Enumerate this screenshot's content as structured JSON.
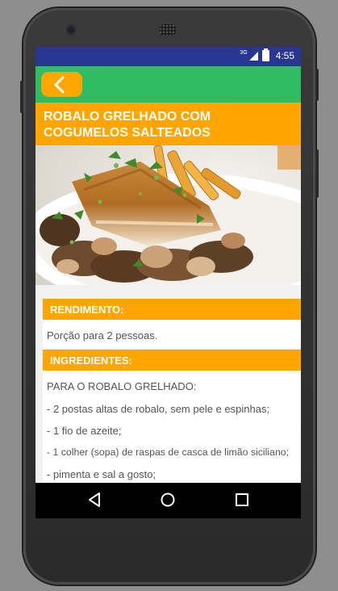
{
  "status_bar": {
    "network": "3G",
    "time": "4:55"
  },
  "app_bar": {
    "back_icon": "chevron-left-icon"
  },
  "recipe": {
    "title": "ROBALO GRELHADO COM COGUMELOS SALTEADOS",
    "yield_header": "RENDIMENTO:",
    "yield_text": "Porção para 2 pessoas.",
    "ingredients_header": "INGREDIENTES:",
    "ingredients": [
      "PARA O ROBALO GRELHADO:",
      "- 2 postas altas de robalo, sem pele e espinhas;",
      "- 1 fio de azeite;",
      "- 1 colher (sopa) de raspas de casca de limão siciliano;",
      "- pimenta e sal a gosto;"
    ]
  },
  "nav_bar": {
    "back": "back-icon",
    "home": "home-icon",
    "recents": "recents-icon"
  },
  "colors": {
    "status": "#283593",
    "appbar": "#2ebd63",
    "accent": "#ffa500"
  }
}
